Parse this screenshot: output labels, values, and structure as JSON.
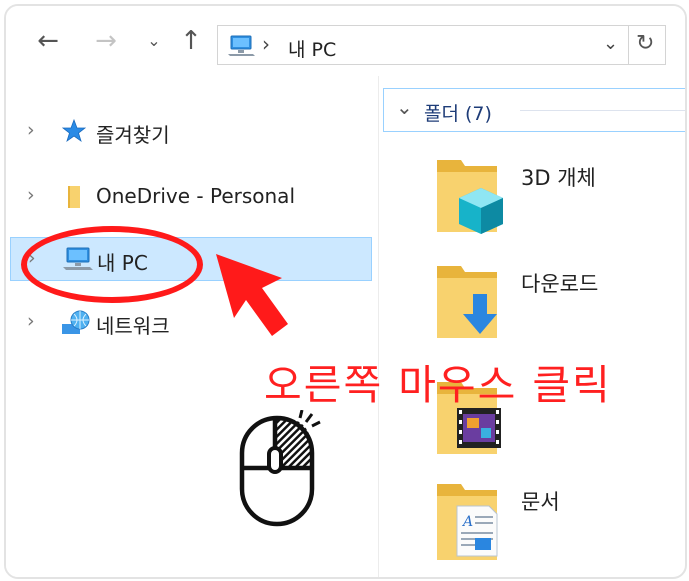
{
  "toolbar": {
    "back_icon": "back-arrow-icon",
    "forward_icon": "forward-arrow-icon",
    "recent_icon": "recent-locations-chevron-icon",
    "up_icon": "up-arrow-icon"
  },
  "address_bar": {
    "path_label": "내 PC",
    "dropdown_icon": "chevron-down-icon",
    "refresh_icon": "refresh-icon"
  },
  "nav_tree": {
    "items": [
      {
        "label": "즐겨찾기",
        "icon": "star-icon",
        "selected": false
      },
      {
        "label": "OneDrive - Personal",
        "icon": "folder-icon",
        "selected": false
      },
      {
        "label": "내 PC",
        "icon": "computer-icon",
        "selected": true
      },
      {
        "label": "네트워크",
        "icon": "network-icon",
        "selected": false
      }
    ]
  },
  "content": {
    "group_header": "폴더 (7)",
    "folders": [
      {
        "label": "3D 개체",
        "icon": "3d-objects-folder-icon"
      },
      {
        "label": "다운로드",
        "icon": "downloads-folder-icon"
      },
      {
        "label": "",
        "icon": "videos-folder-icon"
      },
      {
        "label": "문서",
        "icon": "documents-folder-icon"
      }
    ]
  },
  "annotation": {
    "callout_text": "오른쪽 마우스 클릭",
    "color": "#ff1a1a",
    "mouse_icon": "mouse-right-click-icon",
    "arrow_icon": "red-pointer-arrow-icon"
  },
  "colors": {
    "selection_bg": "#cce8ff",
    "selection_border": "#99d1ff",
    "group_text": "#1e3c78",
    "folder_yellow": "#f5cb5c"
  }
}
